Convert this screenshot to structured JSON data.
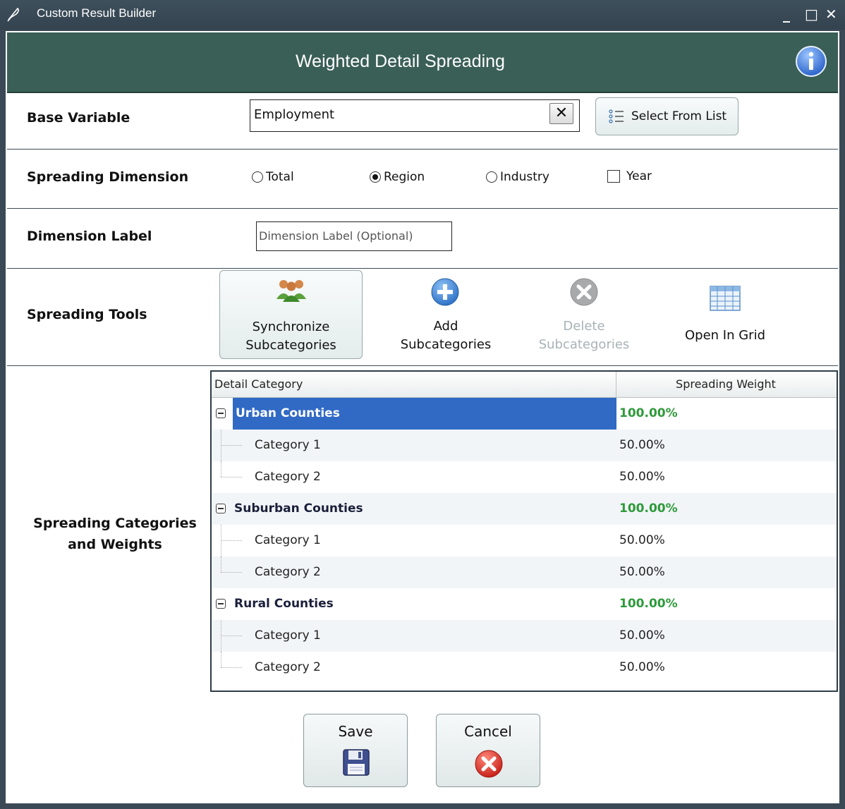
{
  "window": {
    "title": "Custom Result Builder",
    "minimize": "_",
    "maximize": "□",
    "close": "✕"
  },
  "header": {
    "title": "Weighted Detail Spreading",
    "color": "#3a5f56"
  },
  "base_variable": {
    "label": "Base Variable",
    "value": "Employment",
    "clear_glyph": "✕",
    "select_button": "Select From List"
  },
  "spreading_dimension": {
    "label": "Spreading Dimension",
    "options": [
      {
        "label": "Total",
        "selected": false
      },
      {
        "label": "Region",
        "selected": true
      },
      {
        "label": "Industry",
        "selected": false
      }
    ],
    "year_checkbox": {
      "label": "Year",
      "checked": false
    }
  },
  "dimension_label": {
    "label": "Dimension Label",
    "placeholder": "Dimension Label (Optional)"
  },
  "spreading_tools": {
    "label": "Spreading Tools",
    "tools": [
      {
        "line1": "Synchronize",
        "line2": "Subcategories",
        "icon": "people-sync-icon",
        "enabled": true
      },
      {
        "line1": "Add",
        "line2": "Subcategories",
        "icon": "add-circle-icon",
        "enabled": true
      },
      {
        "line1": "Delete",
        "line2": "Subcategories",
        "icon": "delete-circle-icon",
        "enabled": false
      },
      {
        "line1": "Open In Grid",
        "line2": "",
        "icon": "grid-icon",
        "enabled": true
      }
    ]
  },
  "categories": {
    "label_line1": "Spreading Categories",
    "label_line2": "and Weights",
    "columns": [
      "Detail Category",
      "Spreading Weight"
    ],
    "groups": [
      {
        "name": "Urban Counties",
        "weight": "100.00%",
        "selected": true,
        "children": [
          {
            "name": "Category 1",
            "weight": "50.00%"
          },
          {
            "name": "Category 2",
            "weight": "50.00%"
          }
        ]
      },
      {
        "name": "Suburban Counties",
        "weight": "100.00%",
        "selected": false,
        "children": [
          {
            "name": "Category 1",
            "weight": "50.00%"
          },
          {
            "name": "Category 2",
            "weight": "50.00%"
          }
        ]
      },
      {
        "name": "Rural Counties",
        "weight": "100.00%",
        "selected": false,
        "children": [
          {
            "name": "Category 1",
            "weight": "50.00%"
          },
          {
            "name": "Category 2",
            "weight": "50.00%"
          }
        ]
      }
    ]
  },
  "actions": {
    "save": "Save",
    "cancel": "Cancel"
  }
}
